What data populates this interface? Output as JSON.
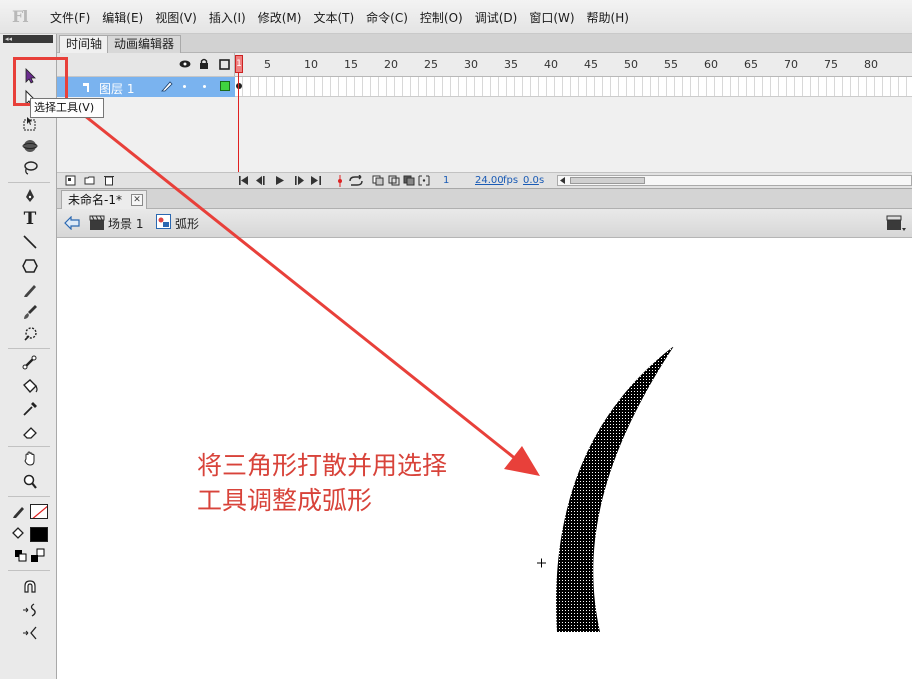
{
  "app": {
    "logo": "Fl"
  },
  "menu": [
    "文件(F)",
    "编辑(E)",
    "视图(V)",
    "插入(I)",
    "修改(M)",
    "文本(T)",
    "命令(C)",
    "控制(O)",
    "调试(D)",
    "窗口(W)",
    "帮助(H)"
  ],
  "tools": {
    "header": "◂◂",
    "tooltip": "选择工具(V)",
    "items": [
      "selection-tool",
      "subselection-tool",
      "free-transform-tool",
      "3d-rotation-tool",
      "lasso-tool",
      "pen-tool",
      "text-tool",
      "line-tool",
      "rectangle-tool",
      "pencil-tool",
      "brush-tool",
      "deco-tool",
      "bone-tool",
      "paint-bucket-tool",
      "eyedropper-tool",
      "eraser-tool",
      "hand-tool",
      "zoom-tool",
      "stroke-color",
      "fill-color",
      "swap-colors",
      "snap-magnet",
      "smooth",
      "straighten"
    ],
    "text_tool_label": "T"
  },
  "timeline": {
    "tabs": [
      "时间轴",
      "动画编辑器"
    ],
    "layer_name": "图层 1",
    "ruler_marks": [
      "1",
      "5",
      "10",
      "15",
      "20",
      "25",
      "30",
      "35",
      "40",
      "45",
      "50",
      "55",
      "60",
      "65",
      "70",
      "75",
      "80"
    ],
    "current_frame": "1",
    "fps": "24.00",
    "fps_unit": "fps",
    "time": "0.0",
    "time_unit": "s"
  },
  "document": {
    "tab": "未命名-1*",
    "close": "✕",
    "scene": "场景 1",
    "symbol": "弧形"
  },
  "stage": {
    "annotation_line1": "将三角形打散并用选择",
    "annotation_line2": "工具调整成弧形"
  },
  "colors": {
    "annotation": "#d8433a",
    "arrow": "#e8403a",
    "layer_selected": "#7ab3ef",
    "playhead": "#e02020",
    "arc_fill": "#000000"
  }
}
